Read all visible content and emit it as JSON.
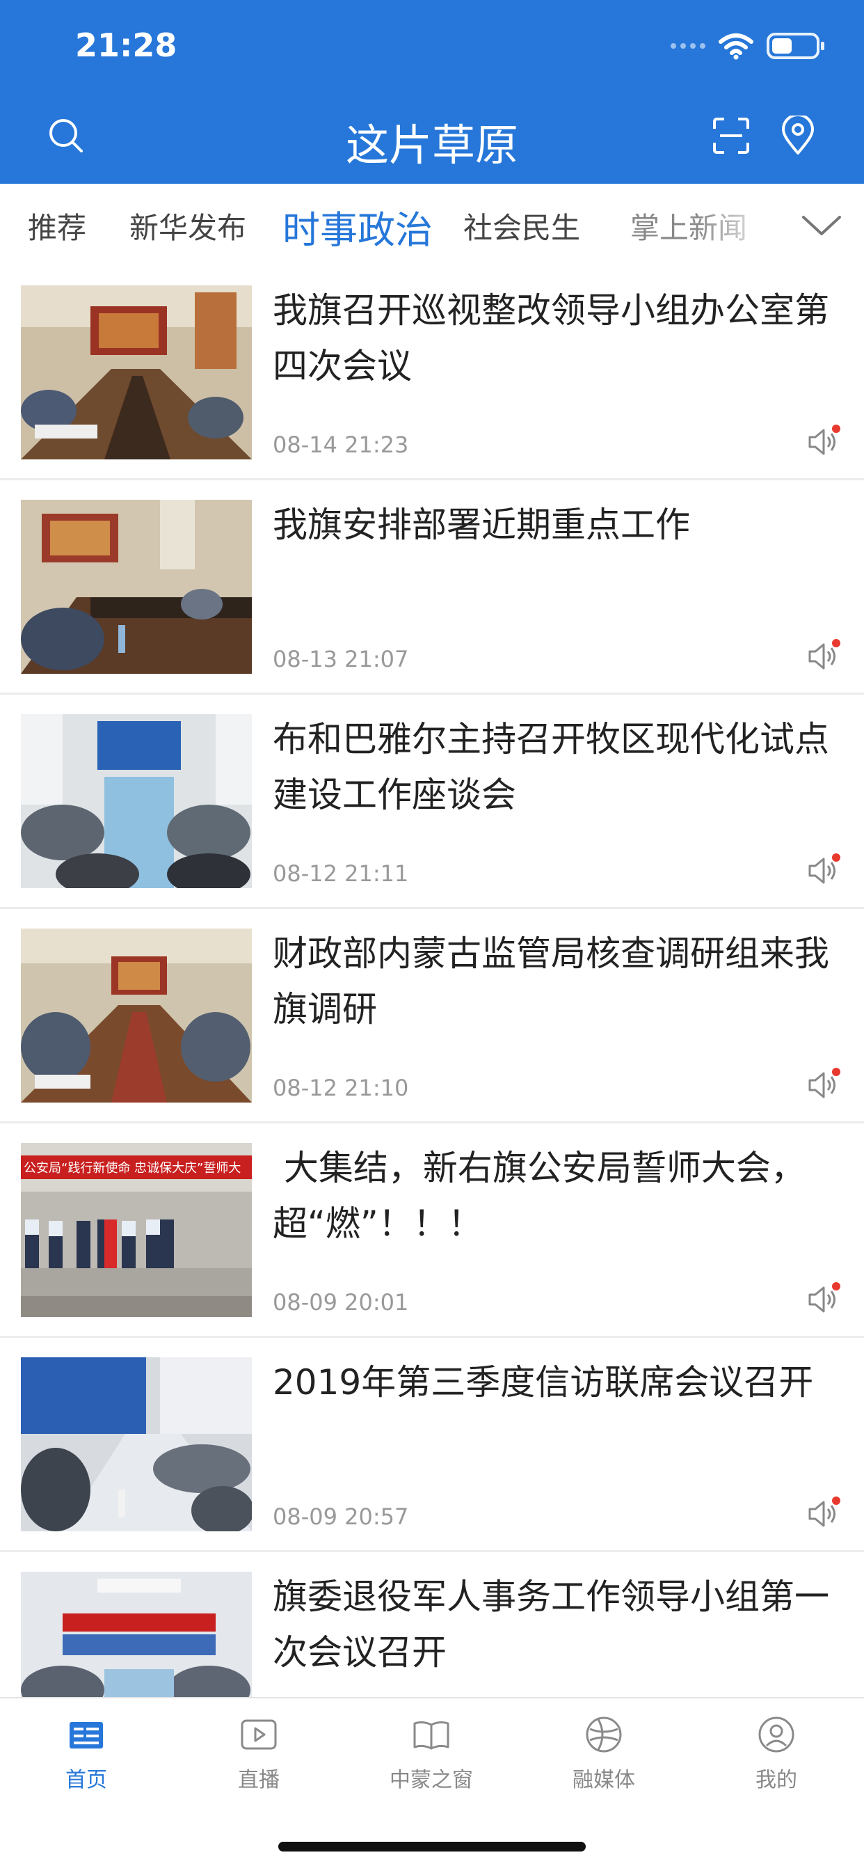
{
  "status_bar": {
    "time": "21:28"
  },
  "header": {
    "title": "这片草原",
    "color": "#2677d9",
    "icons": [
      "search-icon",
      "scan-icon",
      "location-icon"
    ]
  },
  "tabs": [
    {
      "label": "推荐"
    },
    {
      "label": "新华发布"
    },
    {
      "label": "时事政治",
      "active": true
    },
    {
      "label": "社会民生"
    },
    {
      "label": "掌上新闻"
    }
  ],
  "news": [
    {
      "title": "我旗召开巡视整改领导小组办公室第四次会议",
      "time": "08-14 21:23"
    },
    {
      "title": "我旗安排部署近期重点工作",
      "time": "08-13 21:07"
    },
    {
      "title": "布和巴雅尔主持召开牧区现代化试点建设工作座谈会",
      "time": "08-12 21:11"
    },
    {
      "title": "财政部内蒙古监管局核查调研组来我旗调研",
      "time": "08-12 21:10"
    },
    {
      "title": " 大集结，新右旗公安局誓师大会，超“燃”！！！",
      "time": "08-09 20:01",
      "banner": "公安局“践行新使命 忠诚保大庆”誓师大"
    },
    {
      "title": "2019年第三季度信访联席会议召开",
      "time": "08-09 20:57"
    },
    {
      "title": "旗委退役军人事务工作领导小组第一次会议召开",
      "time": ""
    }
  ],
  "bottom_nav": [
    {
      "label": "首页",
      "icon": "news-icon",
      "active": true
    },
    {
      "label": "直播",
      "icon": "play-icon"
    },
    {
      "label": "中蒙之窗",
      "icon": "book-icon"
    },
    {
      "label": "融媒体",
      "icon": "globe-icon"
    },
    {
      "label": "我的",
      "icon": "user-icon"
    }
  ],
  "colors": {
    "accent": "#2677d9",
    "badge": "#e8392f"
  }
}
